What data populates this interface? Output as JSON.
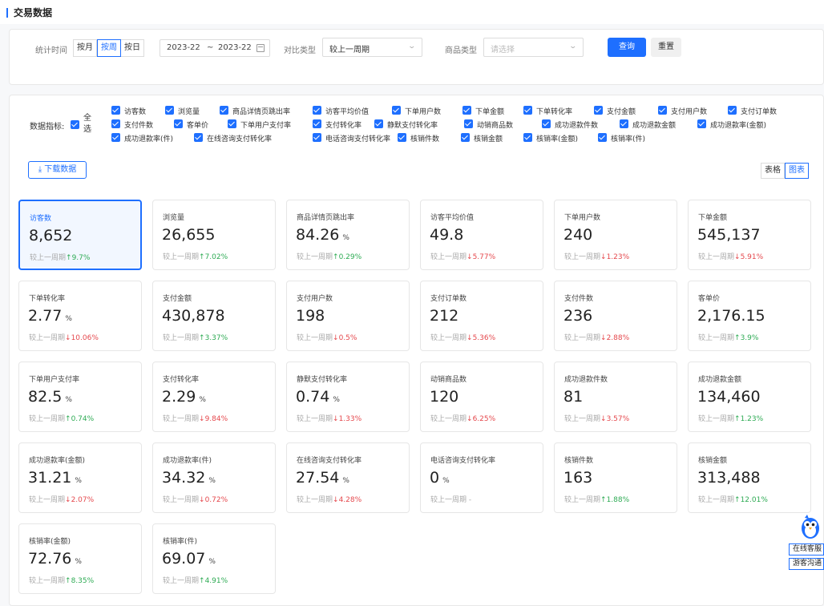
{
  "section_title": "交易数据",
  "filters": {
    "time_label": "统计时间",
    "granularity": [
      "按月",
      "按周",
      "按日"
    ],
    "granularity_selected": "按周",
    "date_start": "2023-22",
    "date_sep": "~",
    "date_end": "2023-22",
    "compare_label": "对比类型",
    "compare_value": "较上一周期",
    "goods_label": "商品类型",
    "goods_placeholder": "请选择",
    "query_label": "查询",
    "reset_label": "重置"
  },
  "metrics_selector": {
    "label": "数据指标:",
    "all_label": "全选",
    "options": [
      "访客数",
      "浏览量",
      "商品详情页跳出率",
      "访客平均价值",
      "下单用户数",
      "下单金额",
      "下单转化率",
      "支付金额",
      "支付用户数",
      "支付订单数",
      "支付件数",
      "客单价",
      "下单用户支付率",
      "支付转化率",
      "静默支付转化率",
      "动销商品数",
      "成功退款件数",
      "成功退款金额",
      "成功退款率(金额)",
      "成功退款率(件)",
      "在线咨询支付转化率",
      "电话咨询支付转化率",
      "核销件数",
      "核销金额",
      "核销率(金额)",
      "核销率(件)"
    ]
  },
  "download_label": "下载数据",
  "view_toggle": {
    "options": [
      "表格",
      "图表"
    ],
    "selected": "图表"
  },
  "compare_prefix": "较上一周期",
  "kpis": [
    {
      "name": "访客数",
      "value": "8,652",
      "unit": "",
      "delta": "9.7%",
      "dir": "up",
      "selected": true
    },
    {
      "name": "浏览量",
      "value": "26,655",
      "unit": "",
      "delta": "7.02%",
      "dir": "up"
    },
    {
      "name": "商品详情页跳出率",
      "value": "84.26",
      "unit": "%",
      "delta": "0.29%",
      "dir": "up"
    },
    {
      "name": "访客平均价值",
      "value": "49.8",
      "unit": "",
      "delta": "5.77%",
      "dir": "down"
    },
    {
      "name": "下单用户数",
      "value": "240",
      "unit": "",
      "delta": "1.23%",
      "dir": "down"
    },
    {
      "name": "下单金额",
      "value": "545,137",
      "unit": "",
      "delta": "5.91%",
      "dir": "down"
    },
    {
      "name": "下单转化率",
      "value": "2.77",
      "unit": "%",
      "delta": "10.06%",
      "dir": "down"
    },
    {
      "name": "支付金额",
      "value": "430,878",
      "unit": "",
      "delta": "3.37%",
      "dir": "up"
    },
    {
      "name": "支付用户数",
      "value": "198",
      "unit": "",
      "delta": "0.5%",
      "dir": "down"
    },
    {
      "name": "支付订单数",
      "value": "212",
      "unit": "",
      "delta": "5.36%",
      "dir": "down"
    },
    {
      "name": "支付件数",
      "value": "236",
      "unit": "",
      "delta": "2.88%",
      "dir": "down"
    },
    {
      "name": "客单价",
      "value": "2,176.15",
      "unit": "",
      "delta": "3.9%",
      "dir": "up"
    },
    {
      "name": "下单用户支付率",
      "value": "82.5",
      "unit": "%",
      "delta": "0.74%",
      "dir": "up"
    },
    {
      "name": "支付转化率",
      "value": "2.29",
      "unit": "%",
      "delta": "9.84%",
      "dir": "down"
    },
    {
      "name": "静默支付转化率",
      "value": "0.74",
      "unit": "%",
      "delta": "1.33%",
      "dir": "down"
    },
    {
      "name": "动销商品数",
      "value": "120",
      "unit": "",
      "delta": "6.25%",
      "dir": "down"
    },
    {
      "name": "成功退款件数",
      "value": "81",
      "unit": "",
      "delta": "3.57%",
      "dir": "down"
    },
    {
      "name": "成功退款金额",
      "value": "134,460",
      "unit": "",
      "delta": "1.23%",
      "dir": "up"
    },
    {
      "name": "成功退款率(金额)",
      "value": "31.21",
      "unit": "%",
      "delta": "2.07%",
      "dir": "down"
    },
    {
      "name": "成功退款率(件)",
      "value": "34.32",
      "unit": "%",
      "delta": "0.72%",
      "dir": "down"
    },
    {
      "name": "在线咨询支付转化率",
      "value": "27.54",
      "unit": "%",
      "delta": "4.28%",
      "dir": "down"
    },
    {
      "name": "电话咨询支付转化率",
      "value": "0",
      "unit": "%",
      "delta": "-",
      "dir": "none"
    },
    {
      "name": "核销件数",
      "value": "163",
      "unit": "",
      "delta": "1.88%",
      "dir": "up"
    },
    {
      "name": "核销金额",
      "value": "313,488",
      "unit": "",
      "delta": "12.01%",
      "dir": "up"
    },
    {
      "name": "核销率(金额)",
      "value": "72.76",
      "unit": "%",
      "delta": "8.35%",
      "dir": "up"
    },
    {
      "name": "核销率(件)",
      "value": "69.07",
      "unit": "%",
      "delta": "4.91%",
      "dir": "up"
    }
  ],
  "assistant": {
    "online_label": "在线客服",
    "visitor_label": "游客沟通"
  },
  "colors": {
    "accent": "#1e6fff",
    "up": "#2eab54",
    "down": "#e5484d"
  }
}
